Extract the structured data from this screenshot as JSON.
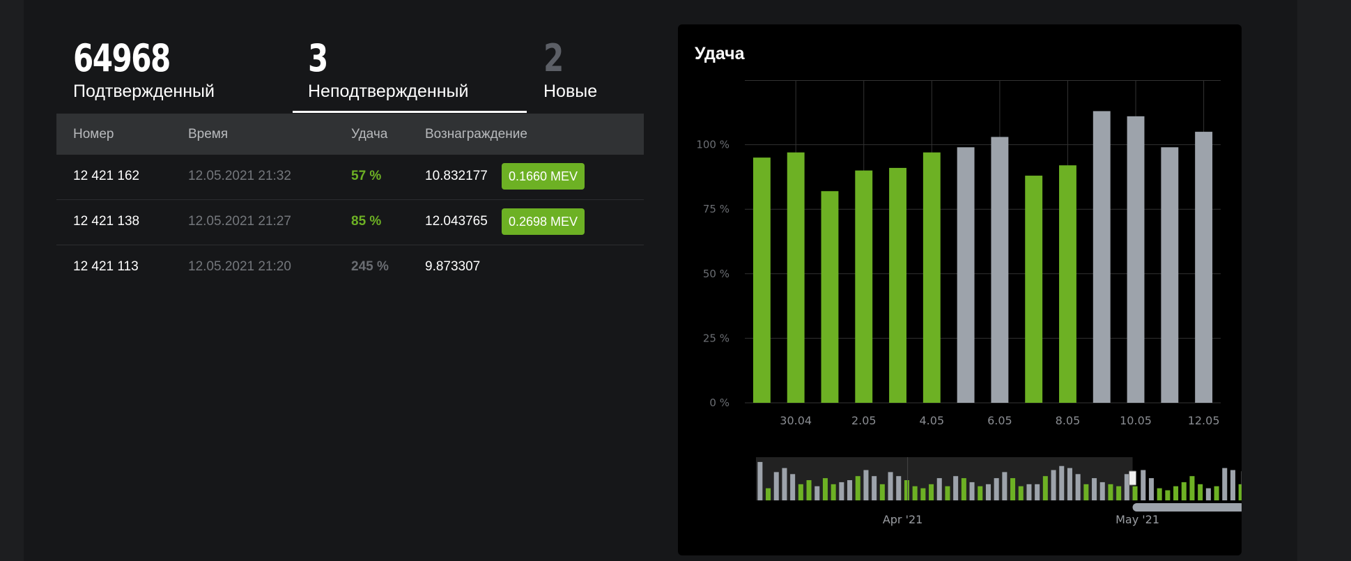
{
  "stats": [
    {
      "value": "64968",
      "label": "Подтвержденный"
    },
    {
      "value": "3",
      "label": "Неподтвержденный"
    },
    {
      "value": "2",
      "label": "Новые"
    }
  ],
  "table": {
    "headers": [
      "Номер",
      "Время",
      "Удача",
      "Вознаграждение"
    ],
    "rows": [
      {
        "number": "12 421 162",
        "time": "12.05.2021 21:32",
        "luck": "57 %",
        "reward": "10.832177",
        "badge": "0.1660 MEV"
      },
      {
        "number": "12 421 138",
        "time": "12.05.2021 21:27",
        "luck": "85 %",
        "reward": "12.043765",
        "badge": "0.2698 MEV"
      },
      {
        "number": "12 421 113",
        "time": "12.05.2021 21:20",
        "luck": "245 %",
        "reward": "9.873307"
      }
    ]
  },
  "colors": {
    "confirmed": "#6db124",
    "unconfirmed": "#9da3ab",
    "luck_high": "#6db124",
    "luck_low": "#6a6d72"
  },
  "chart_data": {
    "type": "bar",
    "title": "Удача",
    "ylim": [
      0,
      125
    ],
    "yticks": [
      "0 %",
      "25 %",
      "50 %",
      "75 %",
      "100 %"
    ],
    "ytick_values": [
      0,
      25,
      50,
      75,
      100
    ],
    "xtick_labels": [
      "30.04",
      "2.05",
      "4.05",
      "6.05",
      "8.05",
      "10.05",
      "12.05"
    ],
    "xtick_positions": [
      1,
      3,
      5,
      7,
      9,
      11,
      13
    ],
    "grid": true,
    "values": [
      95,
      97,
      82,
      90,
      91,
      97,
      99,
      103,
      88,
      92,
      113,
      111,
      99,
      105
    ],
    "status": [
      "confirmed",
      "confirmed",
      "confirmed",
      "confirmed",
      "confirmed",
      "confirmed",
      "unconfirmed",
      "unconfirmed",
      "confirmed",
      "confirmed",
      "unconfirmed",
      "unconfirmed",
      "unconfirmed",
      "unconfirmed"
    ],
    "navigator": {
      "labels": [
        "Apr '21",
        "May '21"
      ],
      "values": [
        95,
        30,
        70,
        80,
        65,
        40,
        50,
        35,
        55,
        40,
        45,
        50,
        60,
        75,
        60,
        40,
        70,
        60,
        50,
        35,
        30,
        40,
        55,
        35,
        60,
        55,
        45,
        35,
        40,
        55,
        70,
        55,
        35,
        40,
        40,
        60,
        75,
        85,
        80,
        65,
        40,
        55,
        45,
        40,
        35,
        65,
        35,
        75,
        55,
        30,
        25,
        35,
        45,
        60,
        40,
        30,
        35,
        80,
        75,
        40
      ],
      "status": [
        "u",
        "c",
        "u",
        "u",
        "u",
        "c",
        "c",
        "u",
        "c",
        "c",
        "u",
        "u",
        "c",
        "u",
        "u",
        "c",
        "u",
        "u",
        "c",
        "c",
        "c",
        "c",
        "u",
        "c",
        "u",
        "c",
        "u",
        "c",
        "u",
        "u",
        "u",
        "c",
        "c",
        "u",
        "u",
        "c",
        "u",
        "u",
        "u",
        "u",
        "c",
        "u",
        "u",
        "c",
        "c",
        "u",
        "c",
        "u",
        "u",
        "c",
        "c",
        "c",
        "c",
        "c",
        "c",
        "u",
        "c",
        "u",
        "u",
        "c"
      ],
      "window": [
        0.77,
        1.0
      ]
    }
  }
}
